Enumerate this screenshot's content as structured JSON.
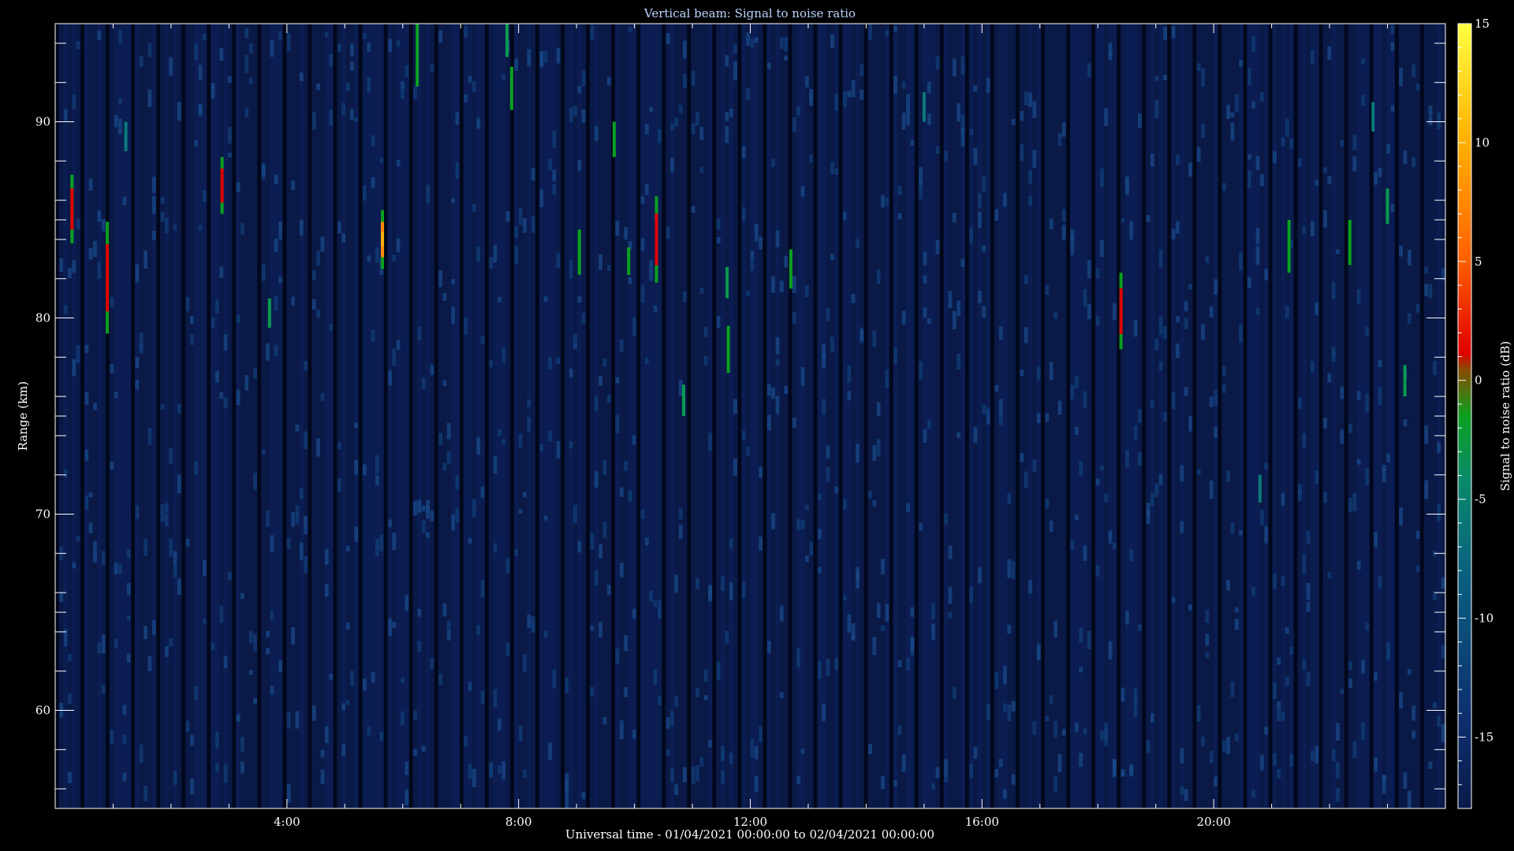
{
  "chart_data": {
    "type": "heatmap",
    "title": "Vertical beam: Signal to noise ratio",
    "xlabel": "Universal time - 01/04/2021 00:00:00 to 02/04/2021 00:00:00",
    "ylabel": "Range (km)",
    "colorbar_label": "Signal to noise ratio (dB)",
    "xlim_hours": [
      0,
      24
    ],
    "ylim_km": [
      55,
      95
    ],
    "clim_db": [
      -18,
      15
    ],
    "x_ticks": [
      {
        "h": 4,
        "label": "4:00"
      },
      {
        "h": 8,
        "label": "8:00"
      },
      {
        "h": 12,
        "label": "12:00"
      },
      {
        "h": 16,
        "label": "16:00"
      },
      {
        "h": 20,
        "label": "20:00"
      }
    ],
    "y_ticks": [
      {
        "km": 60,
        "label": "60"
      },
      {
        "km": 70,
        "label": "70"
      },
      {
        "km": 80,
        "label": "80"
      },
      {
        "km": 90,
        "label": "90"
      }
    ],
    "cbar_ticks": [
      {
        "db": 15,
        "label": "15"
      },
      {
        "db": 10,
        "label": "10"
      },
      {
        "db": 5,
        "label": "5"
      },
      {
        "db": 0,
        "label": "0"
      },
      {
        "db": -5,
        "label": "-5"
      },
      {
        "db": -10,
        "label": "-10"
      },
      {
        "db": -15,
        "label": "-15"
      }
    ],
    "background_db": -15,
    "colormap": [
      "#0a1a4a",
      "#0e3f7a",
      "#0a8a6a",
      "#0aa020",
      "#8a4a00",
      "#e00000",
      "#ff8000",
      "#ffd000",
      "#ffff40"
    ],
    "echoes": [
      {
        "t": 0.29,
        "r0": 83.8,
        "r1": 87.3,
        "peak_db": 1
      },
      {
        "t": 0.9,
        "r0": 79.2,
        "r1": 84.9,
        "peak_db": 2
      },
      {
        "t": 1.22,
        "r0": 88.5,
        "r1": 90.0,
        "peak_db": -12
      },
      {
        "t": 2.88,
        "r0": 85.3,
        "r1": 88.2,
        "peak_db": 2
      },
      {
        "t": 3.7,
        "r0": 79.5,
        "r1": 81.0,
        "peak_db": -7
      },
      {
        "t": 5.65,
        "r0": 82.5,
        "r1": 85.5,
        "peak_db": 7
      },
      {
        "t": 6.25,
        "r0": 91.8,
        "r1": 95.0,
        "peak_db": -6
      },
      {
        "t": 7.8,
        "r0": 93.3,
        "r1": 95.0,
        "peak_db": -10
      },
      {
        "t": 7.88,
        "r0": 90.6,
        "r1": 92.8,
        "peak_db": -6
      },
      {
        "t": 9.05,
        "r0": 82.2,
        "r1": 84.5,
        "peak_db": -6
      },
      {
        "t": 9.65,
        "r0": 88.2,
        "r1": 90.0,
        "peak_db": -6
      },
      {
        "t": 9.9,
        "r0": 82.2,
        "r1": 83.6,
        "peak_db": -6
      },
      {
        "t": 10.38,
        "r0": 81.8,
        "r1": 86.2,
        "peak_db": 4
      },
      {
        "t": 10.85,
        "r0": 75.0,
        "r1": 76.6,
        "peak_db": -8
      },
      {
        "t": 11.6,
        "r0": 81.0,
        "r1": 82.6,
        "peak_db": -8
      },
      {
        "t": 11.62,
        "r0": 77.2,
        "r1": 79.6,
        "peak_db": -6
      },
      {
        "t": 12.7,
        "r0": 81.5,
        "r1": 83.5,
        "peak_db": -6
      },
      {
        "t": 15.0,
        "r0": 90.0,
        "r1": 91.5,
        "peak_db": -13
      },
      {
        "t": 18.4,
        "r0": 78.4,
        "r1": 82.3,
        "peak_db": 0
      },
      {
        "t": 20.8,
        "r0": 70.6,
        "r1": 72.0,
        "peak_db": -14
      },
      {
        "t": 21.3,
        "r0": 82.3,
        "r1": 85.0,
        "peak_db": -6
      },
      {
        "t": 22.35,
        "r0": 82.7,
        "r1": 85.0,
        "peak_db": -6
      },
      {
        "t": 22.75,
        "r0": 89.5,
        "r1": 91.0,
        "peak_db": -12
      },
      {
        "t": 23.0,
        "r0": 84.8,
        "r1": 86.6,
        "peak_db": -10
      },
      {
        "t": 23.3,
        "r0": 76.0,
        "r1": 77.6,
        "peak_db": -8
      }
    ]
  }
}
